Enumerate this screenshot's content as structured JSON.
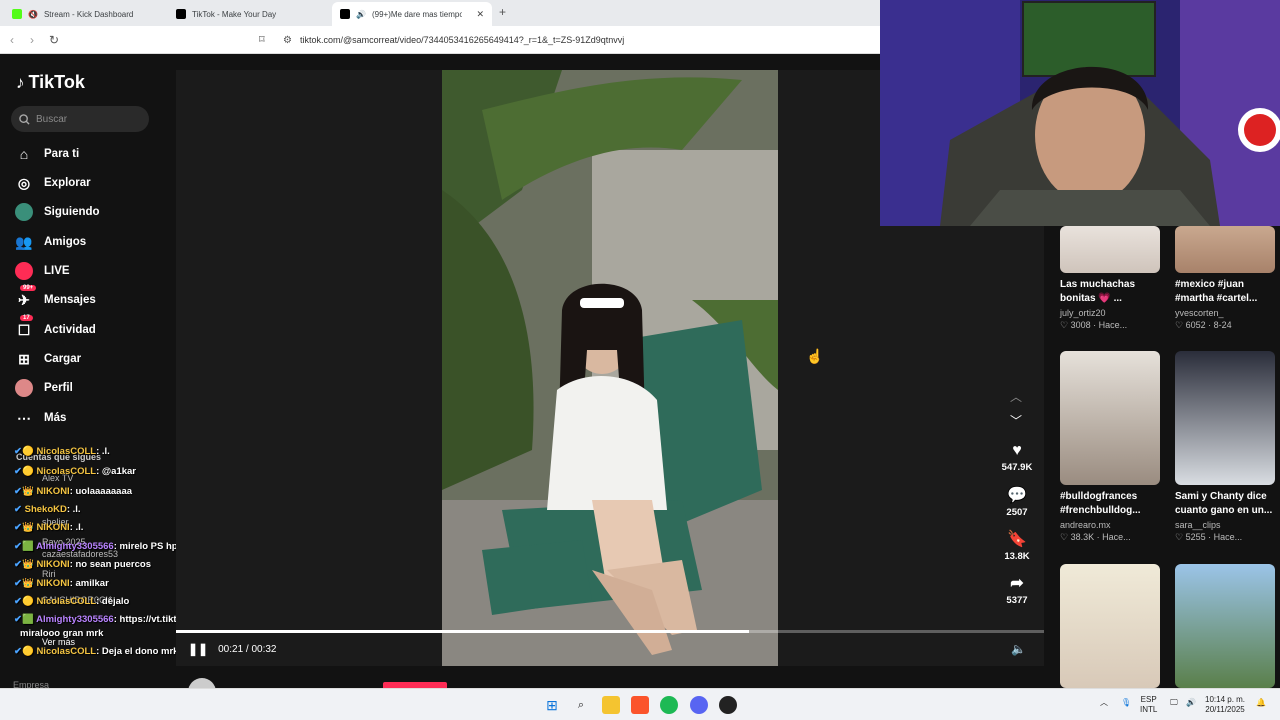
{
  "tabs": [
    {
      "label": "Stream - Kick Dashboard",
      "color": "#53fc18"
    },
    {
      "label": "TikTok - Make Your Day",
      "color": "#000000"
    },
    {
      "label": "(99+)Me dare mas tiempo :3",
      "color": "#000000"
    }
  ],
  "url": "tiktok.com/@samcorreat/video/7344053416265649414?_r=1&_t=ZS-91Zd9qtnvvj",
  "sidebar": {
    "logo": "TikTok",
    "search_placeholder": "Buscar",
    "items": [
      {
        "label": "Para ti",
        "icon": "home-icon"
      },
      {
        "label": "Explorar",
        "icon": "compass-icon"
      },
      {
        "label": "Siguiendo",
        "icon": "following-icon"
      },
      {
        "label": "Amigos",
        "icon": "friends-icon"
      },
      {
        "label": "LIVE",
        "icon": "live-icon"
      },
      {
        "label": "Mensajes",
        "icon": "messages-icon",
        "badge": "99+"
      },
      {
        "label": "Actividad",
        "icon": "activity-icon",
        "badge": "17"
      },
      {
        "label": "Cargar",
        "icon": "upload-icon"
      },
      {
        "label": "Perfil",
        "icon": "profile-icon"
      },
      {
        "label": "Más",
        "icon": "more-icon"
      }
    ],
    "following_header": "Cuentas que sigues",
    "following": [
      "Alex TV",
      "shelier",
      "Rayo 2025",
      "cazaestafadores53",
      "Riri",
      "SALCHIBOR0CK"
    ],
    "see_more": "Ver más",
    "footer": "Empresa"
  },
  "chat": [
    {
      "user": "NicolasCOLL",
      "msg": ".l."
    },
    {
      "user": "NicolasCOLL",
      "msg": "@a1kar"
    },
    {
      "user": "NIKONI",
      "msg": "uolaaaaaaaa"
    },
    {
      "user": "ShekoKD",
      "msg": ".l."
    },
    {
      "user": "NIKONI",
      "msg": ".l."
    },
    {
      "user": "Almighty3305566",
      "msg": "mirelo PS hp"
    },
    {
      "user": "NIKONI",
      "msg": "no sean puercos"
    },
    {
      "user": "NIKONI",
      "msg": "amilkar"
    },
    {
      "user": "NicolasCOLL",
      "msg": "déjalo"
    },
    {
      "user": "Almighty3305566",
      "msg": "https://vt.tiktok.com/ZSfjg6H4T/"
    },
    {
      "user": "",
      "msg": "miralooo gran mrk"
    },
    {
      "user": "NicolasCOLL",
      "msg": "Deja el dono mrka"
    }
  ],
  "video": {
    "time": "00:21 / 00:32",
    "progress": 0.66,
    "author": "samcorreat",
    "likes": "547.9K",
    "comments": "2507",
    "saves": "13.8K",
    "shares": "5377"
  },
  "related": [
    {
      "title": "Las muchachas bonitas 💗 ...",
      "channel": "july_ortiz20",
      "meta": "♡ 3008 · Hace..."
    },
    {
      "title": "#mexico #juan #martha #cartel...",
      "channel": "yvescorten_",
      "meta": "♡ 6052 · 8-24"
    },
    {
      "title": "#bulldogfrances #frenchbulldog...",
      "channel": "andrearo.mx",
      "meta": "♡ 38.3K · Hace..."
    },
    {
      "title": "Sami y Chanty dice cuanto gano en un...",
      "channel": "sara__clips",
      "meta": "♡ 5255 · Hace..."
    },
    {
      "title": "",
      "channel": "",
      "meta": ""
    },
    {
      "title": "",
      "channel": "",
      "meta": ""
    }
  ],
  "taskbar": {
    "lang": "ESP",
    "layout": "INTL",
    "time": "10:14 p. m.",
    "date": "20/11/2025"
  }
}
